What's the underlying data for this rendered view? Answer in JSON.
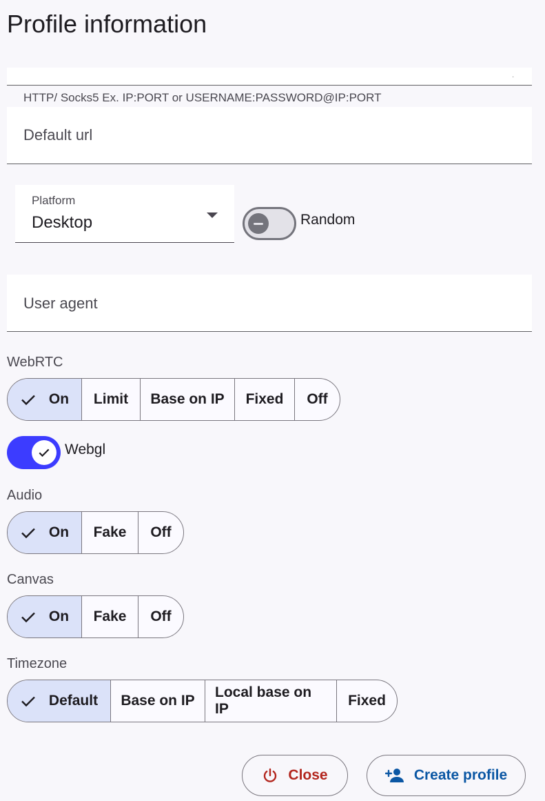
{
  "page_title": "Profile information",
  "proxy": {
    "value": ".",
    "helper": "HTTP/ Socks5 Ex. IP:PORT or USERNAME:PASSWORD@IP:PORT"
  },
  "default_url": {
    "placeholder": "Default url"
  },
  "platform": {
    "label": "Platform",
    "value": "Desktop"
  },
  "random": {
    "label": "Random",
    "enabled": false
  },
  "user_agent": {
    "placeholder": "User agent"
  },
  "webrtc": {
    "label": "WebRTC",
    "options": [
      "On",
      "Limit",
      "Base on IP",
      "Fixed",
      "Off"
    ],
    "selected": "On"
  },
  "webgl": {
    "label": "Webgl",
    "enabled": true
  },
  "audio": {
    "label": "Audio",
    "options": [
      "On",
      "Fake",
      "Off"
    ],
    "selected": "On"
  },
  "canvas": {
    "label": "Canvas",
    "options": [
      "On",
      "Fake",
      "Off"
    ],
    "selected": "On"
  },
  "timezone": {
    "label": "Timezone",
    "options": [
      "Default",
      "Base on IP",
      "Local base on IP",
      "Fixed"
    ],
    "selected": "Default"
  },
  "actions": {
    "close_label": "Close",
    "create_label": "Create profile"
  },
  "colors": {
    "primary": "#3c3cff",
    "selected_segment": "#dbe2f9",
    "close": "#b3261e",
    "create": "#0b57a4"
  },
  "icons": {
    "check": "check-icon",
    "power": "power-icon",
    "add_person": "person-add-icon",
    "dropdown": "chevron-down-icon",
    "minus": "minus-icon"
  }
}
